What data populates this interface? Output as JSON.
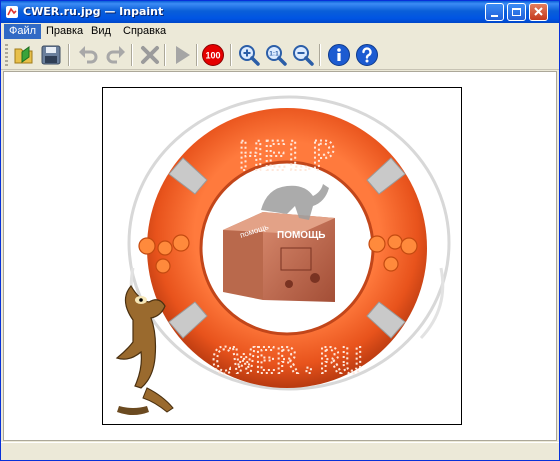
{
  "window": {
    "title": "CWER.ru.jpg — Inpaint"
  },
  "menu": {
    "items": [
      "Файл",
      "Правка",
      "Вид",
      "Справка"
    ],
    "active_index": 0
  },
  "toolbar": {
    "buttons": [
      {
        "name": "open-icon",
        "enabled": true
      },
      {
        "name": "save-icon",
        "enabled": true
      },
      {
        "name": "undo-icon",
        "enabled": false
      },
      {
        "name": "redo-icon",
        "enabled": false
      },
      {
        "name": "clear-selection-icon",
        "enabled": false
      },
      {
        "name": "run-inpaint-icon",
        "enabled": false
      },
      {
        "name": "actual-size-icon",
        "enabled": true
      },
      {
        "name": "zoom-in-icon",
        "enabled": true
      },
      {
        "name": "zoom-fit-icon",
        "enabled": true
      },
      {
        "name": "zoom-out-icon",
        "enabled": true
      },
      {
        "name": "info-icon",
        "enabled": true
      },
      {
        "name": "help-icon",
        "enabled": true
      }
    ],
    "actual_size_label": "100",
    "zoom_fit_label": "1:1"
  },
  "image": {
    "ring_top_text": "HELP",
    "ring_bottom_text": "CWER.RU",
    "box_left_text": "помощь",
    "box_front_text": "ПОМОЩЬ",
    "colors": {
      "ring": "#F0602A",
      "ring_band": "#C9C9C9",
      "box": "#C96A4F"
    }
  }
}
